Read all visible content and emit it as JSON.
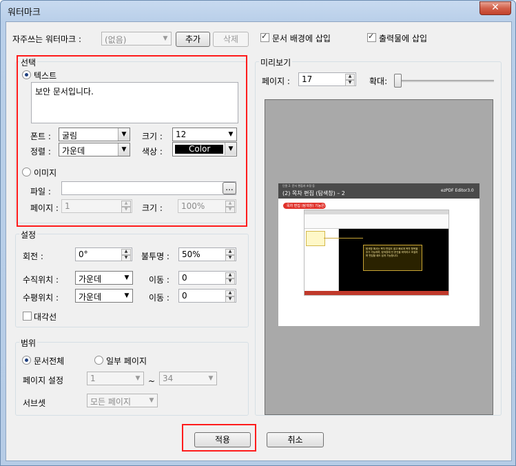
{
  "window": {
    "title": "워터마크",
    "close_label": "✕"
  },
  "top": {
    "common_label": "자주쓰는 워터마크 :",
    "common_value": "(없음)",
    "add_label": "추가",
    "delete_label": "삭제",
    "insert_bg_label": "문서 배경에 삽입",
    "insert_output_label": "출력물에 삽입"
  },
  "select": {
    "legend": "선택",
    "text_radio_label": "텍스트",
    "text_value": "보안 문서입니다.",
    "font_label": "폰트 :",
    "font_value": "굴림",
    "size_label": "크기 :",
    "size_value": "12",
    "align_label": "정렬 :",
    "align_value": "가운데",
    "color_label": "색상 :",
    "color_value": "Color",
    "image_radio_label": "이미지",
    "file_label": "파일 :",
    "browse_label": "...",
    "page_label": "페이지 :",
    "page_value": "1",
    "img_size_label": "크기 :",
    "img_size_value": "100%"
  },
  "settings": {
    "legend": "설정",
    "rotate_label": "회전 :",
    "rotate_value": "0°",
    "opacity_label": "불투명 :",
    "opacity_value": "50%",
    "vpos_label": "수직위치 :",
    "vpos_value": "가운데",
    "vmove_label": "이동 :",
    "vmove_value": "0",
    "hpos_label": "수평위치 :",
    "hpos_value": "가운데",
    "hmove_label": "이동 :",
    "hmove_value": "0",
    "diagonal_label": "대각선"
  },
  "range": {
    "legend": "범위",
    "all_label": "문서전체",
    "partial_label": "일부 페이지",
    "page_set_label": "페이지 설정",
    "from_value": "1",
    "tilde": "~",
    "to_value": "34",
    "subset_label": "서브셋",
    "subset_value": "모든 페이지"
  },
  "preview": {
    "legend": "미리보기",
    "page_label": "페이지 :",
    "page_value": "17",
    "zoom_label": "확대:",
    "slide_heading_small": "단원 2. 문서 편집과 조정 등",
    "slide_title": "(2) 목차 편집 (탐색창) – 2",
    "slide_brand": "ezPDF Editor3.0",
    "slide_tag": "목차 편집 (탐색창) 기능은?",
    "slide_callout": "탐색창 에서는 목차 편집도 쉽고 빠르게 목차 항목을 추가 가능하며, 탐색창에 전 문건을 파악하고 조절하며 편집할 때도 쉽게 가능합니다."
  },
  "buttons": {
    "apply_label": "적용",
    "cancel_label": "취소"
  },
  "colors": {
    "highlight": "#ff1b1b",
    "color_swatch": "#000000",
    "slide_header": "#4a4a4a",
    "slide_tag": "#e0322b"
  }
}
